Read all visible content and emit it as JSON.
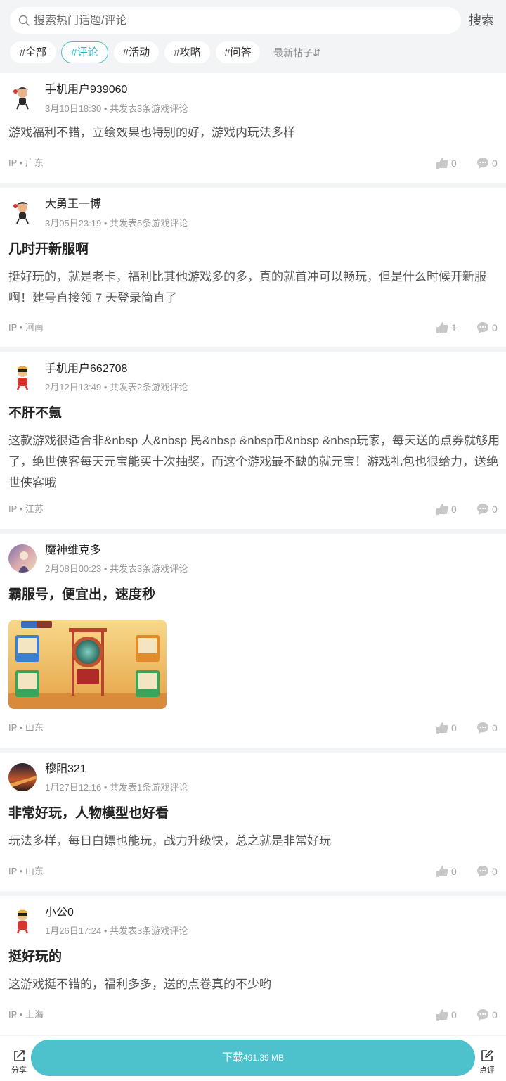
{
  "header": {
    "search_placeholder": "搜索热门话题/评论",
    "search_button": "搜索",
    "tags": [
      "#全部",
      "#评论",
      "#活动",
      "#攻略",
      "#问答"
    ],
    "active_tag": "#评论",
    "sort_label": "最新帖子⇵"
  },
  "posts": [
    {
      "user": "手机用户939060",
      "time": "3月10日18:30",
      "sep": "•",
      "count": "共发表3条游戏评论",
      "title": "",
      "body": "游戏福利不错，立绘效果也特别的好，游戏内玩法多样",
      "ip": "IP • 广东",
      "likes": "0",
      "comments": "0"
    },
    {
      "user": "大勇王一博",
      "time": "3月05日23:19",
      "sep": "•",
      "count": "共发表5条游戏评论",
      "title": "几时开新服啊",
      "body": "挺好玩的，就是老卡，福利比其他游戏多的多，真的就首冲可以畅玩，但是什么时候开新服啊！建号直接领 7 天登录简直了",
      "ip": "IP • 河南",
      "likes": "1",
      "comments": "0"
    },
    {
      "user": "手机用户662708",
      "time": "2月12日13:49",
      "sep": "•",
      "count": "共发表2条游戏评论",
      "title": "不肝不氪",
      "body": "这款游戏很适合非&nbsp 人&nbsp 民&nbsp &nbsp币&nbsp &nbsp玩家，每天送的点券就够用了，绝世侠客每天元宝能买十次抽奖，而这个游戏最不缺的就元宝！游戏礼包也很给力，送绝世侠客哦",
      "ip": "IP • 江苏",
      "likes": "0",
      "comments": "0"
    },
    {
      "user": "魔神维克多",
      "time": "2月08日00:23",
      "sep": "•",
      "count": "共发表3条游戏评论",
      "title": "霸服号，便宜出，速度秒",
      "body": "",
      "ip": "IP • 山东",
      "likes": "0",
      "comments": "0"
    },
    {
      "user": "穆阳321",
      "time": "1月27日12:16",
      "sep": "•",
      "count": "共发表1条游戏评论",
      "title": "非常好玩，人物模型也好看",
      "body": "玩法多样，每日白嫖也能玩，战力升级快，总之就是非常好玩",
      "ip": "IP • 山东",
      "likes": "0",
      "comments": "0"
    },
    {
      "user": "小公0",
      "time": "1月26日17:24",
      "sep": "•",
      "count": "共发表3条游戏评论",
      "title": "挺好玩的",
      "body": "这游戏挺不错的，福利多多，送的点卷真的不少哟",
      "ip": "IP • 上海",
      "likes": "0",
      "comments": "0"
    }
  ],
  "bottom": {
    "share_label": "分享",
    "download_label": "下载",
    "download_size": "491.39 MB",
    "rate_label": "点评"
  },
  "colors": {
    "accent": "#4ec2cc",
    "tag_active": "#2fb4c1",
    "page_bg": "#f3f4f6"
  }
}
